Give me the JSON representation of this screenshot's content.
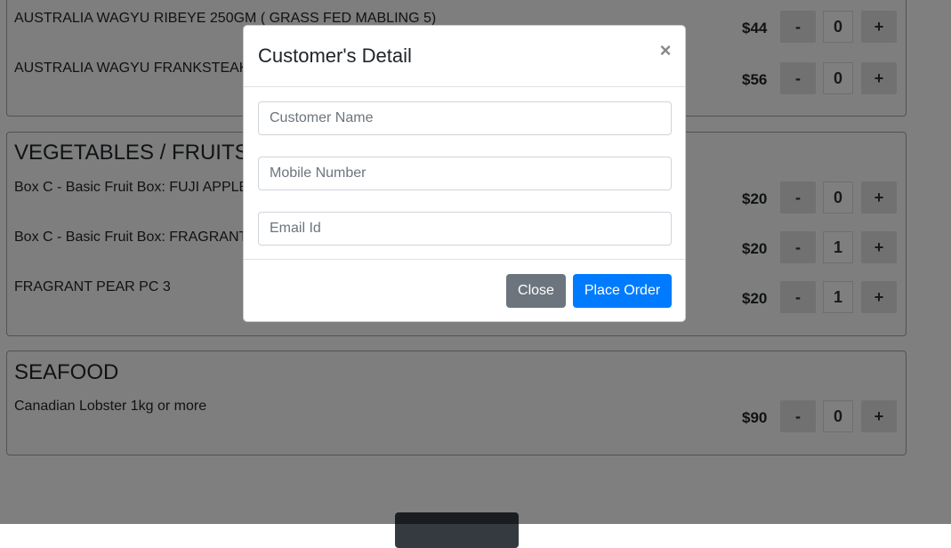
{
  "categories": [
    {
      "title": "",
      "products": [
        {
          "name": "AUSTRALIA WAGYU RIBEYE 250GM ( GRASS FED MABLING 5)",
          "price": "$44",
          "qty": "0"
        },
        {
          "name": "AUSTRALIA WAGYU FRANKSTEAK",
          "price": "$56",
          "qty": "0"
        }
      ]
    },
    {
      "title": "VEGETABLES / FRUITS",
      "products": [
        {
          "name": "Box C - Basic Fruit Box: FUJI APPLE",
          "price": "$20",
          "qty": "0"
        },
        {
          "name": "Box C - Basic Fruit Box: FRAGRANT",
          "price": "$20",
          "qty": "1"
        },
        {
          "name": "FRAGRANT PEAR PC 3",
          "price": "$20",
          "qty": "1"
        }
      ]
    },
    {
      "title": "SEAFOOD",
      "products": [
        {
          "name": "Canadian Lobster 1kg or more",
          "price": "$90",
          "qty": "0"
        }
      ]
    }
  ],
  "qty_controls": {
    "minus_label": "-",
    "plus_label": "+"
  },
  "checkout": {
    "label": ""
  },
  "modal": {
    "title": "Customer's Detail",
    "close_icon_label": "×",
    "fields": {
      "name_placeholder": "Customer Name",
      "mobile_placeholder": "Mobile Number",
      "email_placeholder": "Email Id"
    },
    "close_label": "Close",
    "order_label": "Place Order"
  },
  "colors": {
    "primary": "#007bff",
    "secondary": "#6c757d",
    "backdrop": "rgba(0,0,0,0.5)"
  }
}
